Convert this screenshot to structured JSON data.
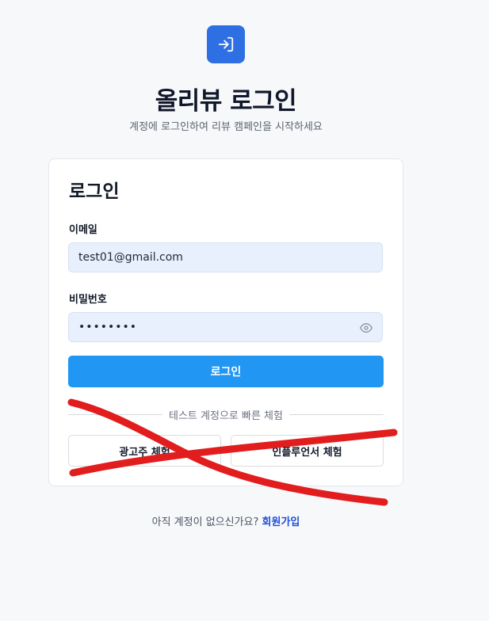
{
  "header": {
    "title": "올리뷰 로그인",
    "subtitle": "계정에 로그인하여 리뷰 캠페인을 시작하세요",
    "logo_icon": "login-arrow-icon",
    "accent_color": "#2f6fe4"
  },
  "card": {
    "title": "로그인",
    "email_label": "이메일",
    "email_value": "test01@gmail.com",
    "password_label": "비밀번호",
    "password_value": "••••••••",
    "password_toggle_icon": "eye-icon",
    "login_button": "로그인",
    "login_button_color": "#2196f3",
    "divider_text": "테스트 계정으로 빠른 체험",
    "demo_buttons": [
      {
        "label": "광고주 체험"
      },
      {
        "label": "인플루언서 체험"
      }
    ]
  },
  "footer": {
    "prompt": "아직 계정이 없으신가요?",
    "signup_link": "회원가입"
  },
  "annotation": {
    "color": "#e11d1d"
  }
}
